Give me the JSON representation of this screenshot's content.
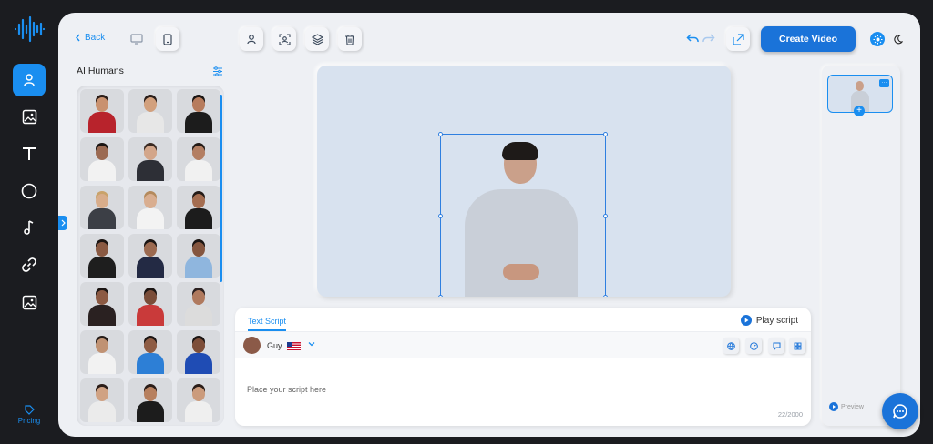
{
  "toolbar": {
    "back_label": "Back",
    "create_label": "Create Video"
  },
  "sidebar": {
    "items": [
      {
        "icon": "user-icon",
        "active": true
      },
      {
        "icon": "image-icon"
      },
      {
        "icon": "text-icon"
      },
      {
        "icon": "shape-icon"
      },
      {
        "icon": "music-icon"
      },
      {
        "icon": "link-icon"
      },
      {
        "icon": "media-icon"
      }
    ],
    "pricing_label": "Pricing"
  },
  "panel": {
    "title": "AI Humans",
    "avatars": [
      {
        "skin": "#c9916f",
        "hair": "#2b1d18",
        "top": "#b8232c"
      },
      {
        "skin": "#d2a07d",
        "hair": "#2a1e1a",
        "top": "#e7e7e7"
      },
      {
        "skin": "#b77c5d",
        "hair": "#1a1513",
        "top": "#1c1c1c"
      },
      {
        "skin": "#9b6a52",
        "hair": "#1a1513",
        "top": "#f2f2f2"
      },
      {
        "skin": "#d3a68a",
        "hair": "#3a2a22",
        "top": "#2d2f36"
      },
      {
        "skin": "#b37e62",
        "hair": "#241b17",
        "top": "#f1f1f1"
      },
      {
        "skin": "#d8ad8b",
        "hair": "#c9a36b",
        "top": "#3c3f46"
      },
      {
        "skin": "#d9ae90",
        "hair": "#b48a5c",
        "top": "#f3f3f3"
      },
      {
        "skin": "#a46d50",
        "hair": "#241b17",
        "top": "#1c1c1c"
      },
      {
        "skin": "#8a5a43",
        "hair": "#1b1513",
        "top": "#1e1e1e"
      },
      {
        "skin": "#9c6a50",
        "hair": "#1b1513",
        "top": "#232a44"
      },
      {
        "skin": "#85563f",
        "hair": "#1b1513",
        "top": "#8fb6de"
      },
      {
        "skin": "#8c5a43",
        "hair": "#1b1513",
        "top": "#2a2121"
      },
      {
        "skin": "#7a4d39",
        "hair": "#1b1513",
        "top": "#c93a3a"
      },
      {
        "skin": "#b07a5e",
        "hair": "#2b2020",
        "top": "#dcdcdc"
      },
      {
        "skin": "#c09273",
        "hair": "#241b17",
        "top": "#f2f2f2"
      },
      {
        "skin": "#8e5c44",
        "hair": "#1b1513",
        "top": "#2d7fd6"
      },
      {
        "skin": "#7d4e39",
        "hair": "#1b1513",
        "top": "#1f4cb4"
      },
      {
        "skin": "#d0a283",
        "hair": "#2b1d18",
        "top": "#ebebeb"
      },
      {
        "skin": "#b7805f",
        "hair": "#2b1d18",
        "top": "#1c1c1c"
      },
      {
        "skin": "#cb9b7c",
        "hair": "#2b1d18",
        "top": "#efefef"
      }
    ]
  },
  "script": {
    "tab_label": "Text Script",
    "play_label": "Play script",
    "voice_name": "Guy",
    "placeholder": "Place your script here",
    "char_count": "22/2000"
  },
  "right_panel": {
    "preview_label": "Preview"
  },
  "colors": {
    "accent": "#1a8ef0",
    "create_button": "#1a73d9",
    "canvas_bg": "#d8e2ef"
  }
}
